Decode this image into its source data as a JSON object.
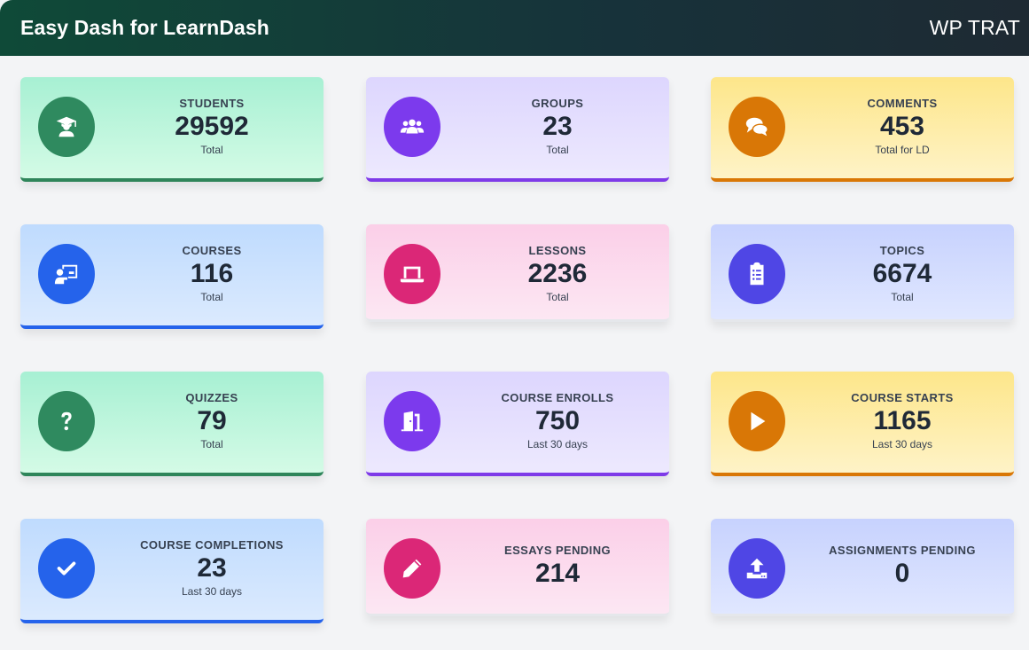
{
  "header": {
    "title": "Easy Dash for LearnDash",
    "brand": "WP TRAT"
  },
  "cards": [
    {
      "label": "STUDENTS",
      "value": "29592",
      "sub": "Total",
      "icon": "graduate-icon"
    },
    {
      "label": "GROUPS",
      "value": "23",
      "sub": "Total",
      "icon": "users-group-icon"
    },
    {
      "label": "COMMENTS",
      "value": "453",
      "sub": "Total for LD",
      "icon": "comments-icon"
    },
    {
      "label": "COURSES",
      "value": "116",
      "sub": "Total",
      "icon": "teacher-board-icon"
    },
    {
      "label": "LESSONS",
      "value": "2236",
      "sub": "Total",
      "icon": "laptop-icon"
    },
    {
      "label": "TOPICS",
      "value": "6674",
      "sub": "Total",
      "icon": "clipboard-list-icon"
    },
    {
      "label": "QUIZZES",
      "value": "79",
      "sub": "Total",
      "icon": "question-icon"
    },
    {
      "label": "COURSE ENROLLS",
      "value": "750",
      "sub": "Last 30 days",
      "icon": "door-enter-icon"
    },
    {
      "label": "COURSE STARTS",
      "value": "1165",
      "sub": "Last 30 days",
      "icon": "play-icon"
    },
    {
      "label": "COURSE COMPLETIONS",
      "value": "23",
      "sub": "Last 30 days",
      "icon": "check-icon"
    },
    {
      "label": "ESSAYS PENDING",
      "value": "214",
      "icon": "pencil-icon"
    },
    {
      "label": "ASSIGNMENTS PENDING",
      "value": "0",
      "icon": "upload-icon"
    }
  ],
  "colors": {
    "green": "#2f8a5f",
    "purple": "#7c3aed",
    "orange": "#d97706",
    "blue": "#2563eb",
    "pink": "#db2777",
    "indigo": "#4f46e5"
  }
}
